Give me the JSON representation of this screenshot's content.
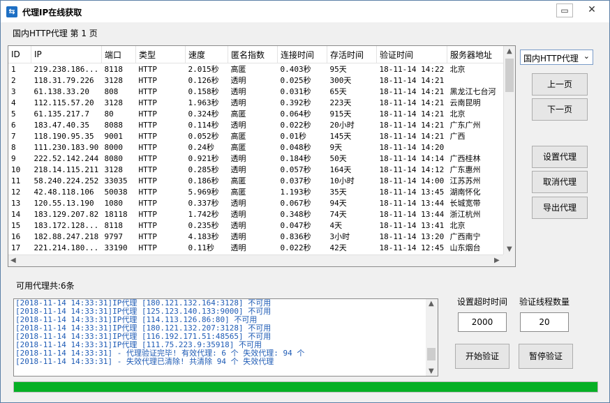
{
  "window": {
    "title": "代理IP在线获取"
  },
  "page_label": "国内HTTP代理   第 1 页",
  "table": {
    "columns": [
      "ID",
      "IP",
      "端口",
      "类型",
      "速度",
      "匿名指数",
      "连接时间",
      "存活时间",
      "验证时间",
      "服务器地址"
    ],
    "rows": [
      [
        "1",
        "219.238.186...",
        "8118",
        "HTTP",
        "2.015秒",
        "高匿",
        "0.403秒",
        "95天",
        "18-11-14 14:22",
        "北京"
      ],
      [
        "2",
        "118.31.79.226",
        "3128",
        "HTTP",
        "0.126秒",
        "透明",
        "0.025秒",
        "300天",
        "18-11-14 14:21",
        ""
      ],
      [
        "3",
        "61.138.33.20",
        "808",
        "HTTP",
        "0.158秒",
        "透明",
        "0.031秒",
        "65天",
        "18-11-14 14:21",
        "黑龙江七台河"
      ],
      [
        "4",
        "112.115.57.20",
        "3128",
        "HTTP",
        "1.963秒",
        "透明",
        "0.392秒",
        "223天",
        "18-11-14 14:21",
        "云南昆明"
      ],
      [
        "5",
        "61.135.217.7",
        "80",
        "HTTP",
        "0.324秒",
        "高匿",
        "0.064秒",
        "915天",
        "18-11-14 14:21",
        "北京"
      ],
      [
        "6",
        "183.47.40.35",
        "8088",
        "HTTP",
        "0.114秒",
        "透明",
        "0.022秒",
        "20小时",
        "18-11-14 14:21",
        "广东广州"
      ],
      [
        "7",
        "118.190.95.35",
        "9001",
        "HTTP",
        "0.052秒",
        "高匿",
        "0.01秒",
        "145天",
        "18-11-14 14:21",
        "广西"
      ],
      [
        "8",
        "111.230.183.90",
        "8000",
        "HTTP",
        "0.24秒",
        "高匿",
        "0.048秒",
        "9天",
        "18-11-14 14:20",
        ""
      ],
      [
        "9",
        "222.52.142.244",
        "8080",
        "HTTP",
        "0.921秒",
        "透明",
        "0.184秒",
        "50天",
        "18-11-14 14:14",
        "广西桂林"
      ],
      [
        "10",
        "218.14.115.211",
        "3128",
        "HTTP",
        "0.285秒",
        "透明",
        "0.057秒",
        "164天",
        "18-11-14 14:12",
        "广东惠州"
      ],
      [
        "11",
        "58.240.224.252",
        "33035",
        "HTTP",
        "0.186秒",
        "高匿",
        "0.037秒",
        "10小时",
        "18-11-14 14:00",
        "江苏苏州"
      ],
      [
        "12",
        "42.48.118.106",
        "50038",
        "HTTP",
        "5.969秒",
        "高匿",
        "1.193秒",
        "35天",
        "18-11-14 13:45",
        "湖南怀化"
      ],
      [
        "13",
        "120.55.13.190",
        "1080",
        "HTTP",
        "0.337秒",
        "透明",
        "0.067秒",
        "94天",
        "18-11-14 13:44",
        "长城宽带"
      ],
      [
        "14",
        "183.129.207.82",
        "18118",
        "HTTP",
        "1.742秒",
        "透明",
        "0.348秒",
        "74天",
        "18-11-14 13:44",
        "浙江杭州"
      ],
      [
        "15",
        "183.172.128...",
        "8118",
        "HTTP",
        "0.235秒",
        "透明",
        "0.047秒",
        "4天",
        "18-11-14 13:41",
        "北京"
      ],
      [
        "16",
        "182.88.247.218",
        "9797",
        "HTTP",
        "4.183秒",
        "透明",
        "0.836秒",
        "3小时",
        "18-11-14 13:20",
        "广西南宁"
      ],
      [
        "17",
        "221.214.180...",
        "33190",
        "HTTP",
        "0.11秒",
        "透明",
        "0.022秒",
        "42天",
        "18-11-14 12:45",
        "山东烟台"
      ]
    ]
  },
  "proxy_type_select": {
    "value": "国内HTTP代理"
  },
  "buttons": {
    "prev": "上一页",
    "next": "下一页",
    "set_proxy": "设置代理",
    "cancel_proxy": "取消代理",
    "export_proxy": "导出代理",
    "start_verify": "开始验证",
    "pause_verify": "暂停验证"
  },
  "status": "可用代理共:6条",
  "log_lines": [
    "[2018-11-14 14:33:31]IP代理 [180.121.132.164:3128] 不可用",
    "[2018-11-14 14:33:31]IP代理 [125.123.140.133:9000] 不可用",
    "[2018-11-14 14:33:31]IP代理 [114.113.126.86:80] 不可用",
    "[2018-11-14 14:33:31]IP代理 [180.121.132.207:3128] 不可用",
    "[2018-11-14 14:33:31]IP代理 [116.192.171.51:48565] 不可用",
    "[2018-11-14 14:33:31]IP代理 [111.75.223.9:35918] 不可用",
    "[2018-11-14 14:33:31] - 代理验证完毕! 有效代理: 6 个 失效代理: 94 个",
    "[2018-11-14 14:33:31] - 失效代理已清除! 共清除 94 个 失效代理"
  ],
  "timeout": {
    "label": "设置超时时间",
    "value": "2000"
  },
  "threads": {
    "label": "验证线程数量",
    "value": "20"
  },
  "progress": {
    "percent": 100
  },
  "colors": {
    "log_text": "#1e5bb5",
    "progress": "#06b025"
  }
}
